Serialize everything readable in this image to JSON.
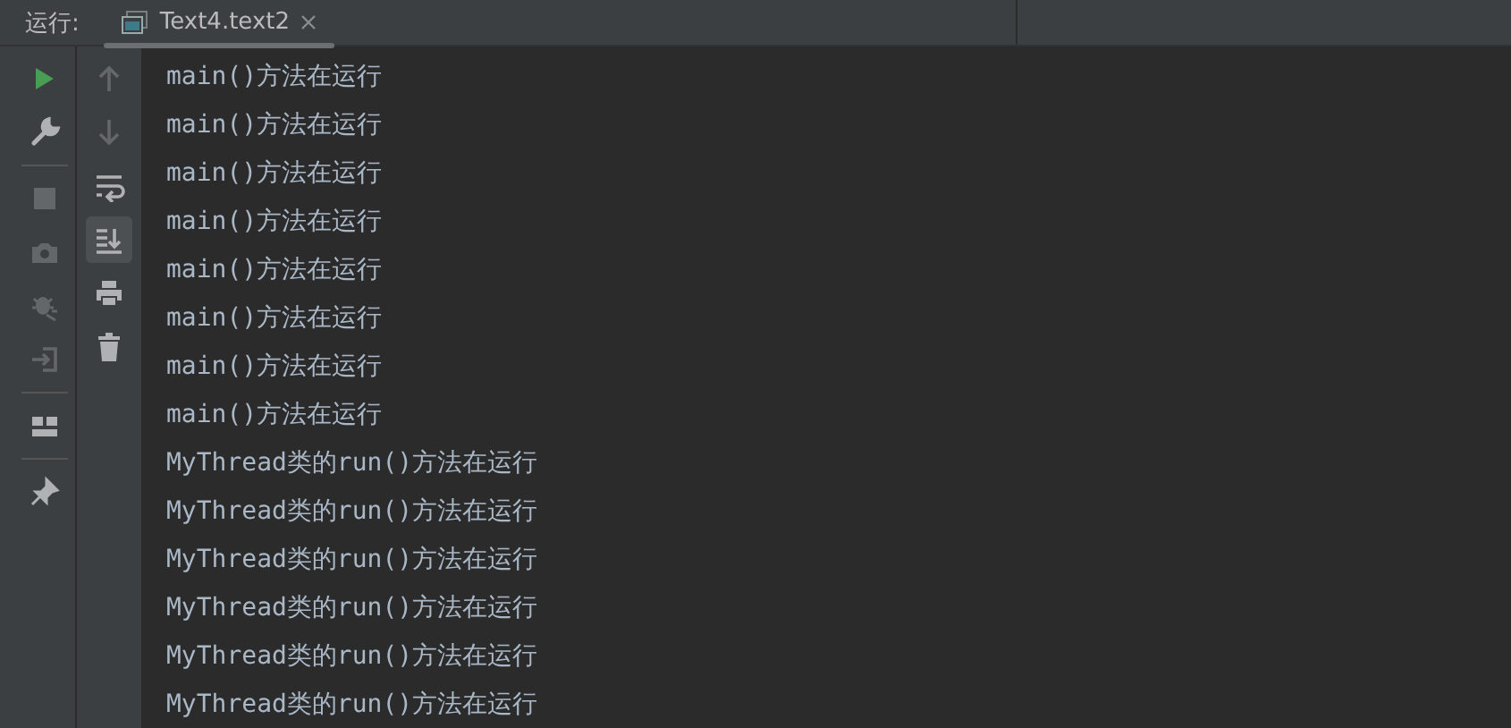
{
  "run_panel": {
    "label": "运行:",
    "tabs": [
      {
        "label": "Text4.text2",
        "selected": true
      }
    ]
  },
  "side_toolbar": {
    "groups": [
      [
        {
          "disabled": false
        },
        {
          "disabled": false
        }
      ],
      [
        {
          "disabled": true
        },
        {
          "disabled": true
        },
        {
          "disabled": true
        },
        {
          "disabled": true
        }
      ],
      [
        {
          "disabled": false
        }
      ],
      [
        {
          "disabled": false
        }
      ]
    ]
  },
  "console_toolbar": [
    {
      "disabled": true,
      "selected": false
    },
    {
      "disabled": true,
      "selected": false
    },
    {
      "disabled": false,
      "selected": false
    },
    {
      "disabled": false,
      "selected": true
    },
    {
      "disabled": false,
      "selected": false
    },
    {
      "disabled": false,
      "selected": false
    }
  ],
  "console": {
    "lines": [
      "main()方法在运行",
      "main()方法在运行",
      "main()方法在运行",
      "main()方法在运行",
      "main()方法在运行",
      "main()方法在运行",
      "main()方法在运行",
      "main()方法在运行",
      "MyThread类的run()方法在运行",
      "MyThread类的run()方法在运行",
      "MyThread类的run()方法在运行",
      "MyThread类的run()方法在运行",
      "MyThread类的run()方法在运行",
      "MyThread类的run()方法在运行"
    ]
  }
}
